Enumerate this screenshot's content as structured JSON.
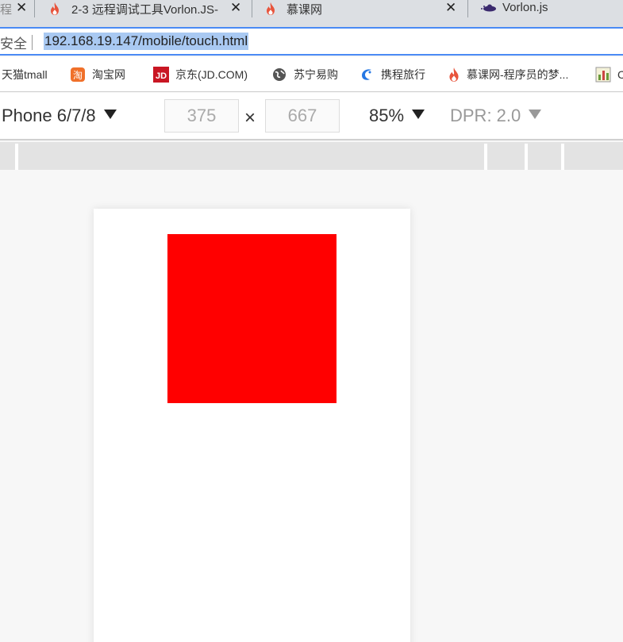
{
  "tabs": [
    {
      "label": "程",
      "close": "✕",
      "icon": "doc-icon"
    },
    {
      "label": "2-3 远程调试工具Vorlon.JS-",
      "close": "✕",
      "icon": "flame-icon"
    },
    {
      "label": "慕课网",
      "close": "✕",
      "icon": "flame-icon"
    },
    {
      "label": "Vorlon.js",
      "close": "",
      "icon": "vorlon-icon"
    }
  ],
  "addressbar": {
    "secure_label": "安全",
    "url": "192.168.19.147/mobile/touch.html"
  },
  "bookmarks": [
    {
      "label": "天猫tmall",
      "icon": "tmall-icon"
    },
    {
      "label": "淘宝网",
      "icon": "taobao-icon"
    },
    {
      "label": "京东(JD.COM)",
      "icon": "jd-icon"
    },
    {
      "label": "苏宁易购",
      "icon": "globe-icon"
    },
    {
      "label": "携程旅行",
      "icon": "ctrip-icon"
    },
    {
      "label": "慕课网-程序员的梦...",
      "icon": "flame-icon"
    },
    {
      "label": "C",
      "icon": "chart-icon"
    }
  ],
  "device_toolbar": {
    "device": "Phone 6/7/8",
    "width": "375",
    "times": "×",
    "height": "667",
    "zoom": "85%",
    "dpr": "DPR: 2.0"
  },
  "colors": {
    "accent": "#4a8af4",
    "touch_box": "#ff0000",
    "url_highlight": "#a9c9f2"
  }
}
